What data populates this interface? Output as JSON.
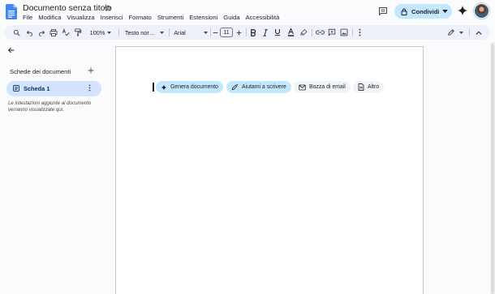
{
  "header": {
    "doc_title": "Documento senza titolo",
    "menus": [
      "File",
      "Modifica",
      "Visualizza",
      "Inserisci",
      "Formato",
      "Strumenti",
      "Estensioni",
      "Guida",
      "Accessibilità"
    ],
    "share_label": "Condividi"
  },
  "toolbar": {
    "zoom": "100%",
    "style": "Testo nor…",
    "font": "Arial",
    "font_size": "11"
  },
  "sidebar": {
    "title": "Schede dei documenti",
    "tab_label": "Scheda 1",
    "hint": "Le intestazioni aggiunte al documento verranno visualizzate qui."
  },
  "page": {
    "chips": [
      {
        "label": "Genera documento",
        "icon": "sparkle-icon"
      },
      {
        "label": "Aiutami a scrivere",
        "icon": "pen-sparkle-icon"
      },
      {
        "label": "Bozza di email",
        "icon": "email-icon"
      },
      {
        "label": "Altro",
        "icon": "doc-more-icon"
      }
    ]
  },
  "colors": {
    "background": "#f9fbfd",
    "toolbar": "#edf2fa",
    "accent_light": "#c2e7ff",
    "active_tab": "#d3e3fd",
    "docs_blue": "#4285f4"
  }
}
